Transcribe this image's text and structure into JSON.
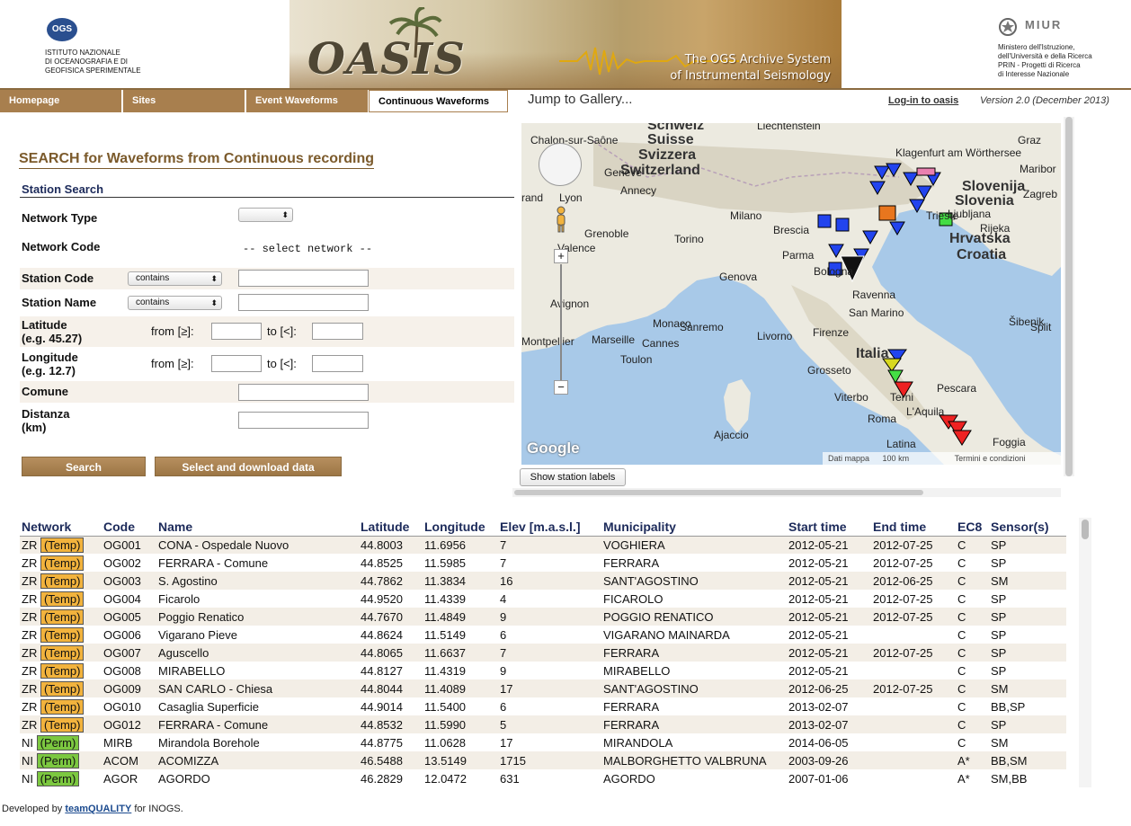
{
  "header": {
    "ogs_badge": "OGS",
    "ogs_name_lines": [
      "ISTITUTO NAZIONALE",
      "DI OCEANOGRAFIA E DI",
      "GEOFISICA SPERIMENTALE"
    ],
    "banner_title": "OASIS",
    "banner_tagline_1": "The OGS Archive System",
    "banner_tagline_2": "of Instrumental Seismology",
    "miur_logo": "MIUR",
    "miur_lines": [
      "Ministero dell'Istruzione,",
      "dell'Università e della Ricerca",
      "PRIN - Progetti di Ricerca",
      "di Interesse Nazionale"
    ]
  },
  "nav": {
    "tabs": [
      "Homepage",
      "Sites",
      "Event Waveforms",
      "Continuous Waveforms"
    ],
    "active_tab": "Continuous Waveforms",
    "gallery": "Jump to Gallery...",
    "login": "Log-in to oasis",
    "version": "Version 2.0 (December 2013)"
  },
  "search": {
    "title": "SEARCH for Waveforms from Continuous recording",
    "section": "Station Search",
    "network_type_label": "Network Type",
    "network_type_value": "",
    "network_code_label": "Network Code",
    "network_code_value": "-- select network --",
    "station_code_label": "Station Code",
    "station_code_mode": "contains",
    "station_name_label": "Station Name",
    "station_name_mode": "contains",
    "latitude_label_1": "Latitude",
    "latitude_label_2": "(e.g. 45.27)",
    "longitude_label_1": "Longitude",
    "longitude_label_2": "(e.g. 12.7)",
    "from_label": "from [≥]:",
    "to_label": "to [<]:",
    "comune_label": "Comune",
    "distanza_label_1": "Distanza",
    "distanza_label_2": "(km)",
    "search_button": "Search",
    "download_button": "Select and download data"
  },
  "map": {
    "labels": [
      "Schweiz",
      "Liechtenstein",
      "Suisse",
      "Svizzera",
      "Switzerland",
      "Chalon-sur-Saône",
      "Geneve",
      "Annecy",
      "Lyon",
      "Grenoble",
      "Valence",
      "Avignon",
      "Marseille",
      "Cannes",
      "Toulon",
      "Monaco",
      "Torino",
      "Milano",
      "Brescia",
      "Genova",
      "Parma",
      "Bologna",
      "Ravenna",
      "San Marino",
      "Firenze",
      "Livorno",
      "Grosseto",
      "Italia",
      "Viterbo",
      "Roma",
      "Latina",
      "Terni",
      "L'Aquila",
      "Pescara",
      "Foggia",
      "Ajaccio",
      "Klagenfurt am Wörthersee",
      "Slovenija",
      "Slovenia",
      "Ljubljana",
      "Trieste",
      "Hrvatska",
      "Croatia",
      "Graz",
      "Maribor",
      "Zagreb",
      "Split",
      "Šibenik",
      "Rijeka",
      "Sanremo",
      "Montpellier",
      "rand"
    ],
    "google": "Google",
    "attribution": "Dati mappa",
    "scale": "100 km",
    "terms": "Termini e condizioni",
    "show_labels_button": "Show station labels",
    "colors": {
      "water": "#a8c9e8",
      "land": "#eceae0",
      "marker_blue": "#2244ee",
      "marker_red": "#ee2222",
      "marker_black": "#111111",
      "marker_orange": "#e8761e",
      "marker_green": "#44dd44"
    }
  },
  "table": {
    "headers": [
      "Network",
      "Code",
      "Name",
      "Latitude",
      "Longitude",
      "Elev [m.a.s.l.]",
      "Municipality",
      "Start time",
      "End time",
      "EC8",
      "Sensor(s)"
    ],
    "rows": [
      {
        "net": "ZR",
        "type": "(Temp)",
        "code": "OG001",
        "name": "CONA - Ospedale Nuovo",
        "lat": "44.8003",
        "lon": "11.6956",
        "elev": "7",
        "muni": "VOGHIERA",
        "start": "2012-05-21",
        "end": "2012-07-25",
        "ec8": "C",
        "sensor": "SP"
      },
      {
        "net": "ZR",
        "type": "(Temp)",
        "code": "OG002",
        "name": "FERRARA - Comune",
        "lat": "44.8525",
        "lon": "11.5985",
        "elev": "7",
        "muni": "FERRARA",
        "start": "2012-05-21",
        "end": "2012-07-25",
        "ec8": "C",
        "sensor": "SP"
      },
      {
        "net": "ZR",
        "type": "(Temp)",
        "code": "OG003",
        "name": "S. Agostino",
        "lat": "44.7862",
        "lon": "11.3834",
        "elev": "16",
        "muni": "SANT'AGOSTINO",
        "start": "2012-05-21",
        "end": "2012-06-25",
        "ec8": "C",
        "sensor": "SM"
      },
      {
        "net": "ZR",
        "type": "(Temp)",
        "code": "OG004",
        "name": "Ficarolo",
        "lat": "44.9520",
        "lon": "11.4339",
        "elev": "4",
        "muni": "FICAROLO",
        "start": "2012-05-21",
        "end": "2012-07-25",
        "ec8": "C",
        "sensor": "SP"
      },
      {
        "net": "ZR",
        "type": "(Temp)",
        "code": "OG005",
        "name": "Poggio Renatico",
        "lat": "44.7670",
        "lon": "11.4849",
        "elev": "9",
        "muni": "POGGIO RENATICO",
        "start": "2012-05-21",
        "end": "2012-07-25",
        "ec8": "C",
        "sensor": "SP"
      },
      {
        "net": "ZR",
        "type": "(Temp)",
        "code": "OG006",
        "name": "Vigarano Pieve",
        "lat": "44.8624",
        "lon": "11.5149",
        "elev": "6",
        "muni": "VIGARANO MAINARDA",
        "start": "2012-05-21",
        "end": "",
        "ec8": "C",
        "sensor": "SP"
      },
      {
        "net": "ZR",
        "type": "(Temp)",
        "code": "OG007",
        "name": "Aguscello",
        "lat": "44.8065",
        "lon": "11.6637",
        "elev": "7",
        "muni": "FERRARA",
        "start": "2012-05-21",
        "end": "2012-07-25",
        "ec8": "C",
        "sensor": "SP"
      },
      {
        "net": "ZR",
        "type": "(Temp)",
        "code": "OG008",
        "name": "MIRABELLO",
        "lat": "44.8127",
        "lon": "11.4319",
        "elev": "9",
        "muni": "MIRABELLO",
        "start": "2012-05-21",
        "end": "",
        "ec8": "C",
        "sensor": "SP"
      },
      {
        "net": "ZR",
        "type": "(Temp)",
        "code": "OG009",
        "name": "SAN CARLO - Chiesa",
        "lat": "44.8044",
        "lon": "11.4089",
        "elev": "17",
        "muni": "SANT'AGOSTINO",
        "start": "2012-06-25",
        "end": "2012-07-25",
        "ec8": "C",
        "sensor": "SM"
      },
      {
        "net": "ZR",
        "type": "(Temp)",
        "code": "OG010",
        "name": "Casaglia Superficie",
        "lat": "44.9014",
        "lon": "11.5400",
        "elev": "6",
        "muni": "FERRARA",
        "start": "2013-02-07",
        "end": "",
        "ec8": "C",
        "sensor": "BB,SP"
      },
      {
        "net": "ZR",
        "type": "(Temp)",
        "code": "OG012",
        "name": "FERRARA - Comune",
        "lat": "44.8532",
        "lon": "11.5990",
        "elev": "5",
        "muni": "FERRARA",
        "start": "2013-02-07",
        "end": "",
        "ec8": "C",
        "sensor": "SP"
      },
      {
        "net": "NI",
        "type": "(Perm)",
        "code": "MIRB",
        "name": "Mirandola Borehole",
        "lat": "44.8775",
        "lon": "11.0628",
        "elev": "17",
        "muni": "MIRANDOLA",
        "start": "2014-06-05",
        "end": "",
        "ec8": "C",
        "sensor": "SM"
      },
      {
        "net": "NI",
        "type": "(Perm)",
        "code": "ACOM",
        "name": "ACOMIZZA",
        "lat": "46.5488",
        "lon": "13.5149",
        "elev": "1715",
        "muni": "MALBORGHETTO VALBRUNA",
        "start": "2003-09-26",
        "end": "",
        "ec8": "A*",
        "sensor": "BB,SM"
      },
      {
        "net": "NI",
        "type": "(Perm)",
        "code": "AGOR",
        "name": "AGORDO",
        "lat": "46.2829",
        "lon": "12.0472",
        "elev": "631",
        "muni": "AGORDO",
        "start": "2007-01-06",
        "end": "",
        "ec8": "A*",
        "sensor": "SM,BB"
      }
    ]
  },
  "footer": {
    "prefix": "Developed by",
    "team": "teamQUALITY",
    "suffix": "for INOGS."
  }
}
